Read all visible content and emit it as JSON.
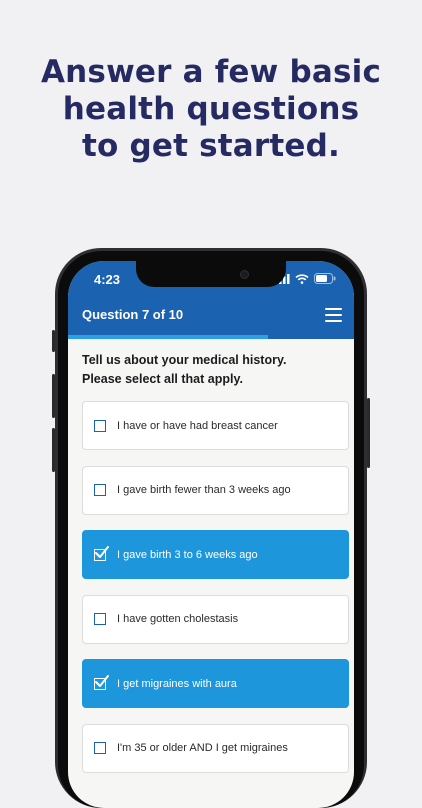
{
  "headline": {
    "line1": "Answer a few basic",
    "line2": "health questions",
    "line3": "to get started."
  },
  "status_bar": {
    "time": "4:23"
  },
  "header": {
    "question_label": "Question 7 of 10",
    "menu_icon": "hamburger-menu-icon"
  },
  "progress": {
    "current": 7,
    "total": 10
  },
  "prompt": {
    "line1": "Tell us about your medical history.",
    "line2": "Please select all that apply."
  },
  "options": [
    {
      "label": "I have or have had breast cancer",
      "checked": false
    },
    {
      "label": "I gave birth fewer than 3 weeks ago",
      "checked": false
    },
    {
      "label": "I gave birth 3 to 6 weeks ago",
      "checked": true
    },
    {
      "label": "I have gotten cholestasis",
      "checked": false
    },
    {
      "label": "I get migraines with aura",
      "checked": true
    },
    {
      "label": "I'm 35 or older AND I get migraines",
      "checked": false
    }
  ],
  "colors": {
    "headline": "#262a63",
    "header": "#1b62b0",
    "progress": "#2e9fe5",
    "selected": "#1e96dc",
    "background": "#f1f1f3"
  }
}
